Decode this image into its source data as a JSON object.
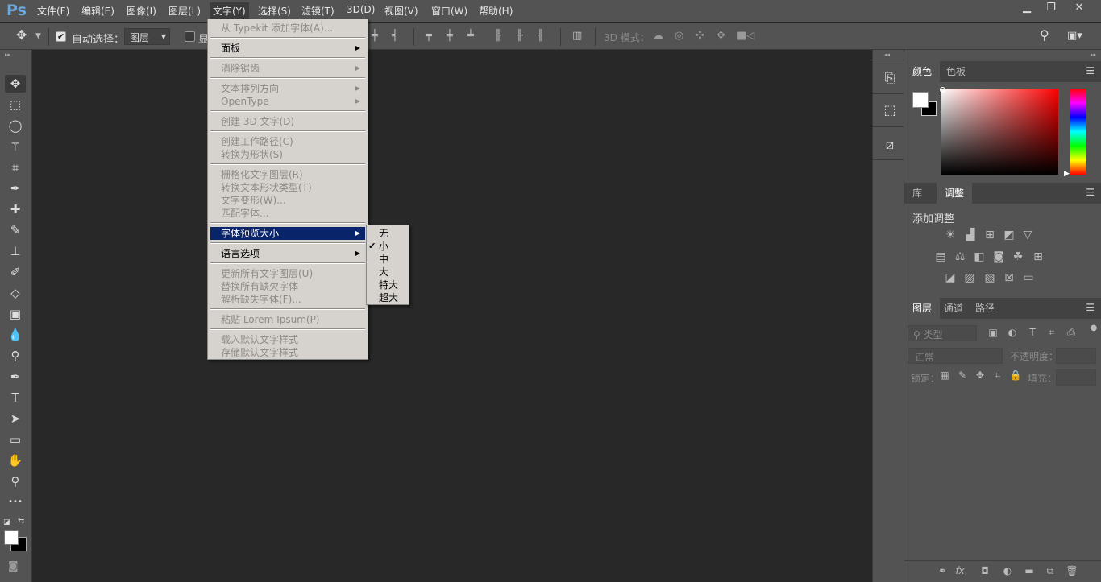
{
  "app": {
    "logo": "Ps"
  },
  "menubar": {
    "items": [
      "文件(F)",
      "编辑(E)",
      "图像(I)",
      "图层(L)",
      "文字(Y)",
      "选择(S)",
      "滤镜(T)",
      "3D(D)",
      "视图(V)",
      "窗口(W)",
      "帮助(H)"
    ],
    "active": "文字(Y)",
    "window_buttons": [
      "minimize",
      "restore",
      "close"
    ]
  },
  "options": {
    "auto_select_label": "自动选择：",
    "auto_select_checked": true,
    "auto_select_value": "图层",
    "show_transform_label": "显",
    "show_transform_checked": false,
    "mode3d_label": "3D 模式："
  },
  "tools": [
    "move",
    "marquee",
    "lasso",
    "magic-wand",
    "crop",
    "eyedropper",
    "healing",
    "brush",
    "stamp",
    "history-brush",
    "eraser",
    "gradient",
    "blur",
    "dodge",
    "pen",
    "type",
    "path-select",
    "rectangle",
    "hand",
    "zoom",
    "more"
  ],
  "type_menu": {
    "items": [
      {
        "label": "从 Typekit 添加字体(A)...",
        "enabled": false
      },
      {
        "sep": true
      },
      {
        "label": "面板",
        "enabled": true,
        "submenu": true
      },
      {
        "sep": true
      },
      {
        "label": "消除锯齿",
        "enabled": false,
        "submenu": true
      },
      {
        "sep": true
      },
      {
        "label": "文本排列方向",
        "enabled": false,
        "submenu": true
      },
      {
        "label": "OpenType",
        "enabled": false,
        "submenu": true
      },
      {
        "sep": true
      },
      {
        "label": "创建 3D 文字(D)",
        "enabled": false
      },
      {
        "sep": true
      },
      {
        "label": "创建工作路径(C)",
        "enabled": false
      },
      {
        "label": "转换为形状(S)",
        "enabled": false
      },
      {
        "sep": true
      },
      {
        "label": "栅格化文字图层(R)",
        "enabled": false
      },
      {
        "label": "转换文本形状类型(T)",
        "enabled": false
      },
      {
        "label": "文字变形(W)...",
        "enabled": false
      },
      {
        "label": "匹配字体...",
        "enabled": false
      },
      {
        "sep": true
      },
      {
        "label": "字体预览大小",
        "enabled": true,
        "submenu": true,
        "highlighted": true
      },
      {
        "sep": true
      },
      {
        "label": "语言选项",
        "enabled": true,
        "submenu": true
      },
      {
        "sep": true
      },
      {
        "label": "更新所有文字图层(U)",
        "enabled": false
      },
      {
        "label": "替换所有缺欠字体",
        "enabled": false
      },
      {
        "label": "解析缺失字体(F)...",
        "enabled": false
      },
      {
        "sep": true
      },
      {
        "label": "粘贴 Lorem Ipsum(P)",
        "enabled": false
      },
      {
        "sep": true
      },
      {
        "label": "载入默认文字样式",
        "enabled": false
      },
      {
        "label": "存储默认文字样式",
        "enabled": false
      }
    ]
  },
  "font_preview_submenu": {
    "items": [
      "无",
      "小",
      "中",
      "大",
      "特大",
      "超大"
    ],
    "checked": "小"
  },
  "panels": {
    "color": {
      "tabs": [
        "颜色",
        "色板"
      ],
      "active": "颜色",
      "foreground": "#ffffff",
      "background": "#000000",
      "hue": "#ff0000"
    },
    "adjust": {
      "tabs": [
        "库",
        "调整"
      ],
      "active": "调整",
      "heading": "添加调整"
    },
    "layers": {
      "tabs": [
        "图层",
        "通道",
        "路径"
      ],
      "active": "图层",
      "filter_placeholder": "类型",
      "blend_mode": "正常",
      "opacity_label": "不透明度：",
      "lock_label": "锁定：",
      "fill_label": "填充："
    }
  }
}
